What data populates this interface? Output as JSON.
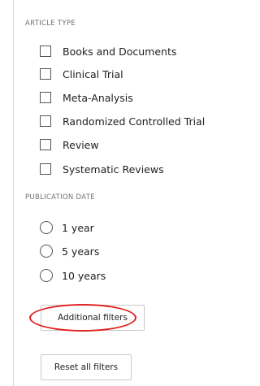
{
  "article_type": {
    "heading": "ARTICLE TYPE",
    "options": [
      {
        "label": "Books and Documents",
        "checked": false
      },
      {
        "label": "Clinical Trial",
        "checked": false
      },
      {
        "label": "Meta-Analysis",
        "checked": false
      },
      {
        "label": "Randomized Controlled Trial",
        "checked": false
      },
      {
        "label": "Review",
        "checked": false
      },
      {
        "label": "Systematic Reviews",
        "checked": false
      }
    ]
  },
  "publication_date": {
    "heading": "PUBLICATION DATE",
    "options": [
      {
        "label": "1 year",
        "selected": false
      },
      {
        "label": "5 years",
        "selected": false
      },
      {
        "label": "10 years",
        "selected": false
      }
    ]
  },
  "buttons": {
    "additional_filters": "Additional filters",
    "reset_all_filters": "Reset all filters"
  },
  "colors": {
    "annotation": "#e02020",
    "border": "#c8c8c8",
    "heading_text": "#707070"
  }
}
